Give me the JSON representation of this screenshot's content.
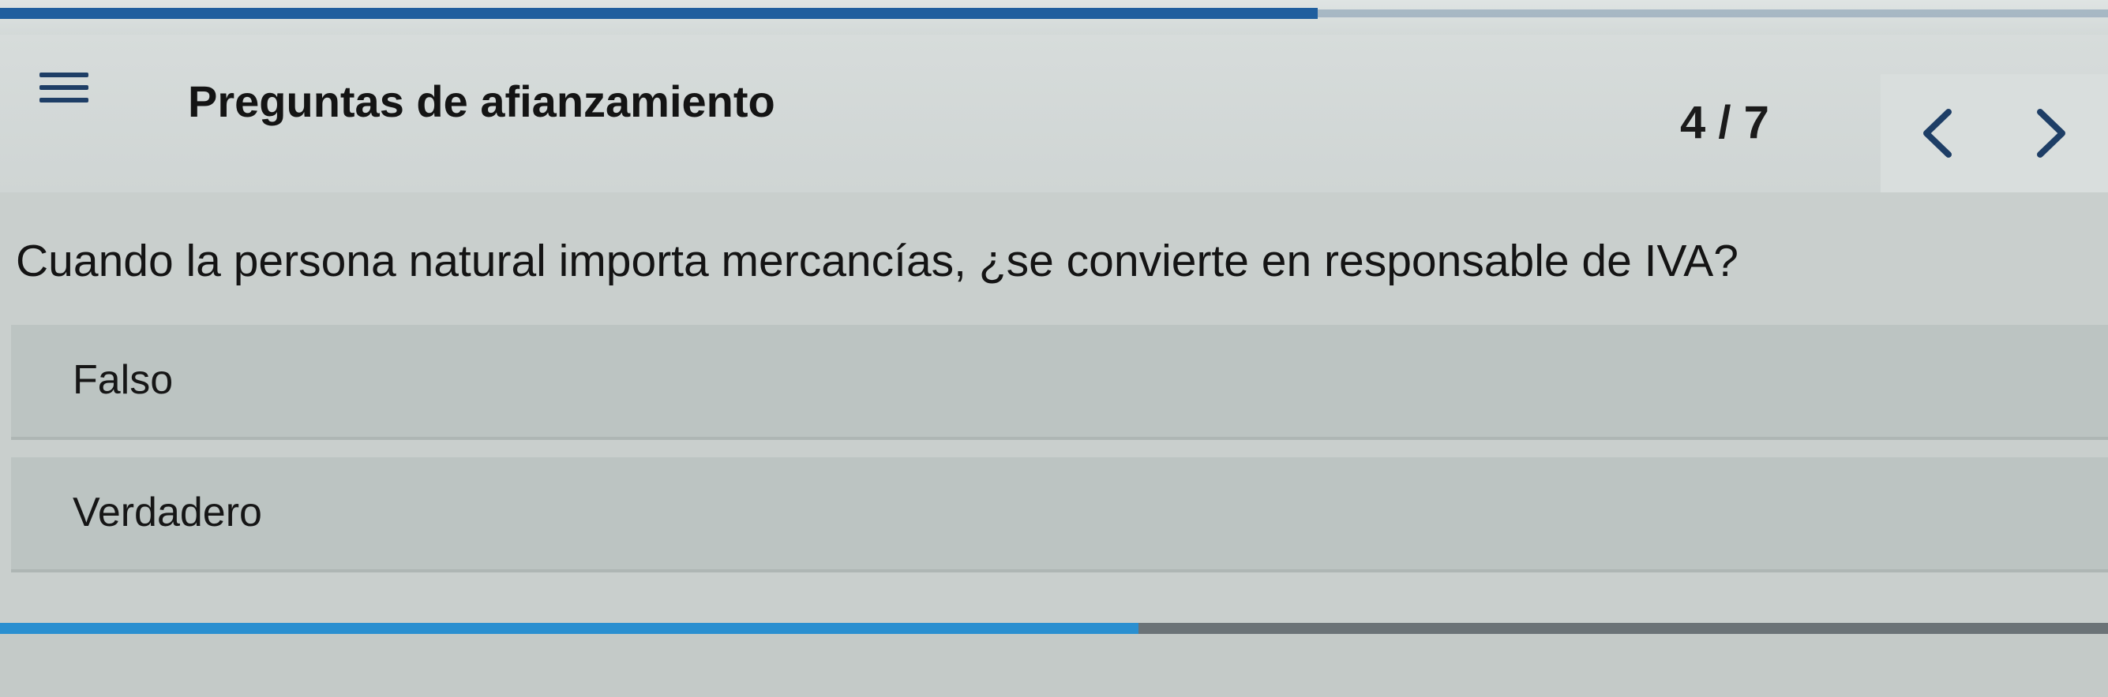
{
  "header": {
    "title": "Preguntas de afianzamiento",
    "counter": "4 / 7",
    "menu_icon": "hamburger-menu-icon",
    "prev_icon": "chevron-left-icon",
    "next_icon": "chevron-right-icon"
  },
  "progress": {
    "fraction": 0.625
  },
  "question": {
    "text": "Cuando la persona natural importa mercancías, ¿se convierte en responsable de IVA?"
  },
  "options": [
    {
      "label": "Falso"
    },
    {
      "label": "Verdadero"
    }
  ],
  "bottom_progress": {
    "answered_fraction": 0.54
  },
  "colors": {
    "accent": "#1f5e9e",
    "answered": "#2a8fd0",
    "remaining": "#6b7377"
  }
}
